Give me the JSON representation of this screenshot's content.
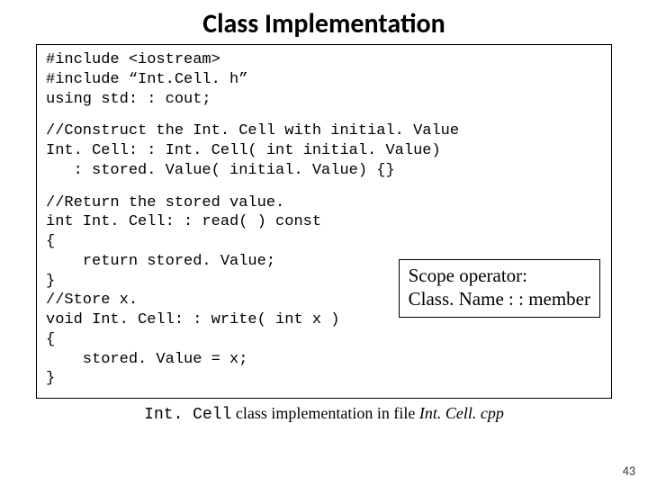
{
  "title": "Class Implementation",
  "code": {
    "block1": "#include <iostream>\n#include “Int.Cell. h”\nusing std: : cout;",
    "block2": "//Construct the Int. Cell with initial. Value\nInt. Cell: : Int. Cell( int initial. Value)\n   : stored. Value( initial. Value) {}",
    "block3": "//Return the stored value.\nint Int. Cell: : read( ) const\n{\n    return stored. Value;\n}\n//Store x.\nvoid Int. Cell: : write( int x )\n{\n    stored. Value = x;\n}"
  },
  "callout": {
    "line1": "Scope operator:",
    "line2": "Class. Name : : member"
  },
  "caption": {
    "code_name": "Int. Cell",
    "middle": " class implementation in file ",
    "file_name": "Int. Cell. cpp"
  },
  "page_number": "43"
}
